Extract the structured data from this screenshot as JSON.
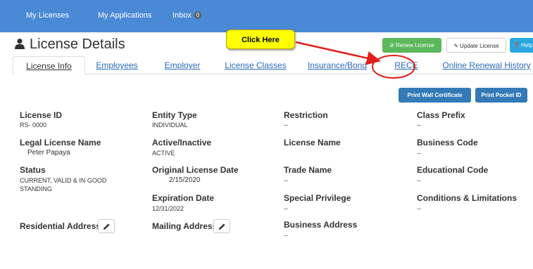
{
  "nav": {
    "items": [
      "My Licenses",
      "My Applications",
      "Inbox"
    ],
    "inbox_count": "0"
  },
  "page_title": "License Details",
  "callout": "Click Here",
  "buttons": {
    "renew": "Renew License",
    "update": "Update License",
    "help": "Help"
  },
  "tabs": [
    "License Info",
    "Employees",
    "Employer",
    "License Classes",
    "Insurance/Bond",
    "RECE",
    "Online Renewal History"
  ],
  "active_tab": "License Info",
  "print_buttons": {
    "wall": "Print Wall Certificate",
    "pocket": "Print Pocket ID"
  },
  "fields": {
    "license_id": {
      "label": "License ID",
      "value": "RS- 0000"
    },
    "entity_type": {
      "label": "Entity Type",
      "value": "INDIVIDUAL"
    },
    "restriction": {
      "label": "Restriction",
      "value": "--"
    },
    "class_prefix": {
      "label": "Class Prefix",
      "value": "--"
    },
    "legal_name": {
      "label": "Legal License Name",
      "value": "Peter Papaya"
    },
    "active_inactive": {
      "label": "Active/Inactive",
      "value": "ACTIVE"
    },
    "license_name": {
      "label": "License Name",
      "value": ""
    },
    "business_code": {
      "label": "Business Code",
      "value": "--"
    },
    "status": {
      "label": "Status",
      "value_line1": "CURRENT, VALID & IN GOOD",
      "value_line2": "STANDING"
    },
    "original_date": {
      "label": "Original License Date",
      "value": "2/15/2020"
    },
    "trade_name": {
      "label": "Trade Name",
      "value": "--"
    },
    "educational_code": {
      "label": "Educational Code",
      "value": "--"
    },
    "expiration_date": {
      "label": "Expiration Date",
      "value": "12/31/2022"
    },
    "special_privilege": {
      "label": "Special Privilege",
      "value": "--"
    },
    "conditions": {
      "label": "Conditions & Limitations",
      "value": "--"
    },
    "residential_address": {
      "label": "Residential Address"
    },
    "mailing_address": {
      "label": "Mailing Address"
    },
    "business_address": {
      "label": "Business Address",
      "value": "--"
    }
  },
  "colors": {
    "navbar": "#4a89d6",
    "callout": "#ffff00",
    "arrow": "#e0201b",
    "renew": "#5cb85c",
    "help": "#2aa7e0",
    "print": "#337ab7",
    "link": "#2a6ab8"
  },
  "icons": {
    "user": "user-icon",
    "renew": "ban-icon",
    "update": "edit-icon",
    "help": "question-circle-icon",
    "edit": "pencil-icon"
  }
}
